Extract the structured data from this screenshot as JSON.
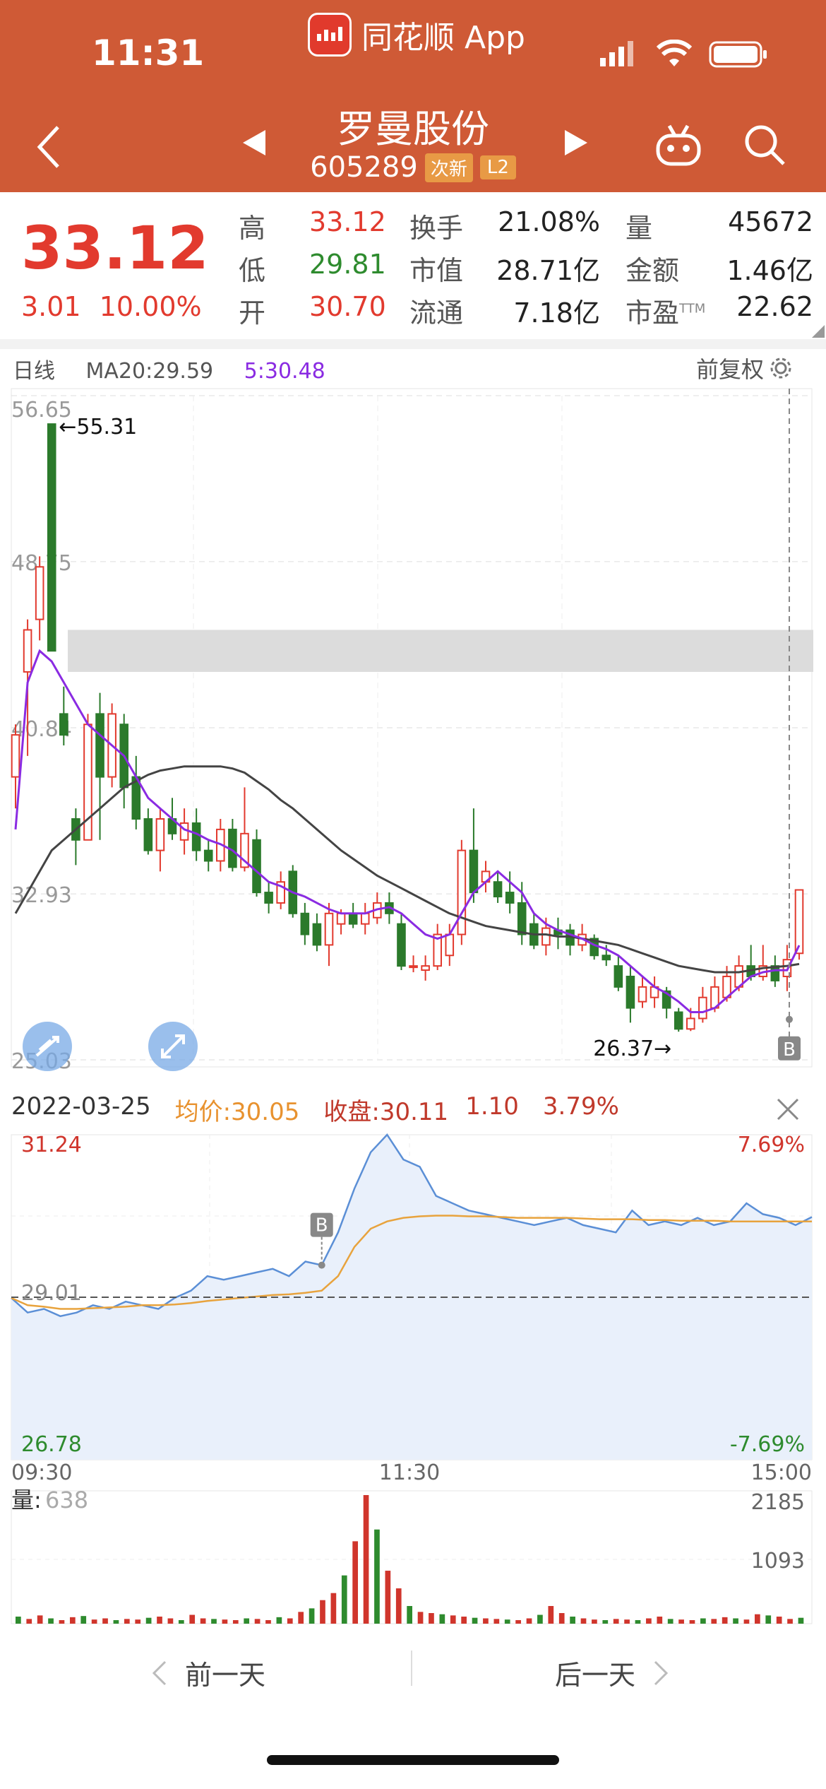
{
  "status": {
    "time": "11:31"
  },
  "header": {
    "app_name": "同花顺 App",
    "stock_name": "罗曼股份",
    "stock_code": "605289",
    "tag_new": "次新",
    "tag_level": "L2"
  },
  "quote": {
    "price": "33.12",
    "change": "3.01",
    "change_pct": "10.00%",
    "high_label": "高",
    "high": "33.12",
    "low_label": "低",
    "low": "29.81",
    "open_label": "开",
    "open": "30.70",
    "turnover_label": "换手",
    "turnover": "21.08%",
    "mktcap_label": "市值",
    "mktcap": "28.71亿",
    "float_label": "流通",
    "float": "7.18亿",
    "volume_label": "量",
    "volume": "45672",
    "amount_label": "金额",
    "amount": "1.46亿",
    "pe_label": "市盈",
    "pe_sup": "TTM",
    "pe": "22.62"
  },
  "kline": {
    "period": "日线",
    "ma20": "MA20:29.59",
    "ma5": "5:30.48",
    "adjust": "前复权",
    "y_ticks": [
      "56.65",
      "48.75",
      "40.84",
      "32.93",
      "25.03"
    ],
    "max_label": "←55.31",
    "min_label": "26.37→",
    "marker_b": "B",
    "colors": {
      "up": "#e23a2e",
      "down": "#2b7a2b",
      "ma5": "#8a2be2",
      "ma20": "#444444"
    }
  },
  "chart_data": [
    {
      "type": "candlestick",
      "title": "日线",
      "ylim": [
        25.03,
        56.65
      ],
      "candles": [
        {
          "o": 38.5,
          "c": 40.5,
          "h": 41,
          "l": 37
        },
        {
          "o": 43.5,
          "c": 45.5,
          "h": 46,
          "l": 39.5
        },
        {
          "o": 46,
          "c": 48.5,
          "h": 49,
          "l": 45
        },
        {
          "o": 55.3,
          "c": 44.5,
          "h": 55.31,
          "l": 44.5
        },
        {
          "o": 41.5,
          "c": 40.5,
          "h": 42.8,
          "l": 40
        },
        {
          "o": 36.5,
          "c": 35.5,
          "h": 37,
          "l": 34.3
        },
        {
          "o": 35.5,
          "c": 41,
          "h": 41.5,
          "l": 35.5
        },
        {
          "o": 41.5,
          "c": 38.5,
          "h": 42.5,
          "l": 35.5
        },
        {
          "o": 38.5,
          "c": 41.5,
          "h": 42,
          "l": 38
        },
        {
          "o": 41,
          "c": 38,
          "h": 41.5,
          "l": 37
        },
        {
          "o": 38.5,
          "c": 36.5,
          "h": 39.5,
          "l": 36
        },
        {
          "o": 36.5,
          "c": 35,
          "h": 37,
          "l": 34.8
        },
        {
          "o": 35,
          "c": 36.5,
          "h": 37,
          "l": 34
        },
        {
          "o": 36.5,
          "c": 35.8,
          "h": 37.5,
          "l": 35.5
        },
        {
          "o": 35.5,
          "c": 36.3,
          "h": 37,
          "l": 34.8
        },
        {
          "o": 36.3,
          "c": 35,
          "h": 37,
          "l": 34.5
        },
        {
          "o": 35,
          "c": 34.5,
          "h": 35.5,
          "l": 34
        },
        {
          "o": 34.5,
          "c": 36,
          "h": 36.5,
          "l": 34
        },
        {
          "o": 36,
          "c": 34.2,
          "h": 36.5,
          "l": 34
        },
        {
          "o": 34.2,
          "c": 35.8,
          "h": 38,
          "l": 34
        },
        {
          "o": 35.5,
          "c": 33,
          "h": 36,
          "l": 32.8
        },
        {
          "o": 33,
          "c": 32.5,
          "h": 33.5,
          "l": 32
        },
        {
          "o": 32.5,
          "c": 33.5,
          "h": 34,
          "l": 32.2
        },
        {
          "o": 34,
          "c": 32,
          "h": 34.3,
          "l": 31.8
        },
        {
          "o": 32,
          "c": 31,
          "h": 32.5,
          "l": 30.5
        },
        {
          "o": 31.5,
          "c": 30.5,
          "h": 32,
          "l": 30.2
        },
        {
          "o": 30.5,
          "c": 32,
          "h": 32.5,
          "l": 29.5
        },
        {
          "o": 31.5,
          "c": 32,
          "h": 32.2,
          "l": 31
        },
        {
          "o": 32,
          "c": 31.5,
          "h": 32.5,
          "l": 31.3
        },
        {
          "o": 31.5,
          "c": 32,
          "h": 32.5,
          "l": 31
        },
        {
          "o": 31.8,
          "c": 32.5,
          "h": 33,
          "l": 31.5
        },
        {
          "o": 32.5,
          "c": 32,
          "h": 33,
          "l": 31.5
        },
        {
          "o": 31.5,
          "c": 29.5,
          "h": 32,
          "l": 29.3
        },
        {
          "o": 29.5,
          "c": 29.5,
          "h": 30,
          "l": 29.2
        },
        {
          "o": 29.3,
          "c": 29.5,
          "h": 30,
          "l": 28.8
        },
        {
          "o": 29.5,
          "c": 31,
          "h": 31.5,
          "l": 29.3
        },
        {
          "o": 30,
          "c": 31,
          "h": 31.5,
          "l": 29.5
        },
        {
          "o": 31,
          "c": 35,
          "h": 35.5,
          "l": 30.5
        },
        {
          "o": 35,
          "c": 33,
          "h": 37,
          "l": 32.5
        },
        {
          "o": 33.5,
          "c": 34,
          "h": 34.5,
          "l": 33
        },
        {
          "o": 33.5,
          "c": 32.8,
          "h": 34,
          "l": 32.5
        },
        {
          "o": 33,
          "c": 32.5,
          "h": 34,
          "l": 32
        },
        {
          "o": 32.5,
          "c": 31,
          "h": 33.5,
          "l": 30.5
        },
        {
          "o": 31.5,
          "c": 30.5,
          "h": 32,
          "l": 30.3
        },
        {
          "o": 30.5,
          "c": 31.3,
          "h": 31.8,
          "l": 30
        },
        {
          "o": 31.2,
          "c": 31,
          "h": 31.8,
          "l": 30.3
        },
        {
          "o": 31.2,
          "c": 30.5,
          "h": 31.5,
          "l": 30
        },
        {
          "o": 30.5,
          "c": 31,
          "h": 31.5,
          "l": 30.2
        },
        {
          "o": 30.8,
          "c": 30,
          "h": 31,
          "l": 29.8
        },
        {
          "o": 30,
          "c": 29.8,
          "h": 30.5,
          "l": 29.5
        },
        {
          "o": 29.5,
          "c": 28.5,
          "h": 30,
          "l": 28.3
        },
        {
          "o": 29,
          "c": 27.5,
          "h": 29.5,
          "l": 26.8
        },
        {
          "o": 27.8,
          "c": 28.5,
          "h": 29,
          "l": 27.5
        },
        {
          "o": 28,
          "c": 28.5,
          "h": 29,
          "l": 27.5
        },
        {
          "o": 28.3,
          "c": 27.5,
          "h": 28.5,
          "l": 27
        },
        {
          "o": 27.3,
          "c": 26.5,
          "h": 27.5,
          "l": 26.37
        },
        {
          "o": 26.5,
          "c": 27,
          "h": 27.5,
          "l": 26.4
        },
        {
          "o": 27,
          "c": 28,
          "h": 28.5,
          "l": 26.8
        },
        {
          "o": 27.5,
          "c": 28.5,
          "h": 29,
          "l": 27.3
        },
        {
          "o": 28,
          "c": 29,
          "h": 29.5,
          "l": 27.8
        },
        {
          "o": 28.5,
          "c": 29.5,
          "h": 30,
          "l": 28.3
        },
        {
          "o": 29.5,
          "c": 29,
          "h": 30.5,
          "l": 28.8
        },
        {
          "o": 29,
          "c": 29.5,
          "h": 30.5,
          "l": 28.8
        },
        {
          "o": 29.5,
          "c": 28.8,
          "h": 30,
          "l": 28.5
        },
        {
          "o": 29,
          "c": 29.8,
          "h": 30.5,
          "l": 28.3
        },
        {
          "o": 30.1,
          "c": 33.12,
          "h": 33.12,
          "l": 29.8
        }
      ],
      "ma5": [
        36,
        43,
        44.5,
        44,
        43,
        42,
        41,
        40.5,
        40,
        39.5,
        38.5,
        37.5,
        37,
        36.5,
        36,
        35.8,
        35.5,
        35.3,
        35,
        34.5,
        34,
        33.5,
        33.3,
        33,
        32.8,
        32.5,
        32.2,
        32,
        32,
        32,
        32.2,
        32.3,
        32,
        31.5,
        31,
        30.8,
        31,
        32,
        33,
        33.5,
        34,
        33.5,
        33,
        32,
        31.5,
        31.2,
        31,
        30.8,
        30.5,
        30.3,
        30,
        29.5,
        29,
        28.5,
        28.2,
        27.8,
        27.3,
        27.3,
        27.5,
        28,
        28.5,
        29,
        29.2,
        29.3,
        29.3,
        30.48
      ],
      "ma20": [
        32,
        33,
        34,
        35,
        35.5,
        36,
        36.5,
        37,
        37.5,
        38,
        38.3,
        38.6,
        38.8,
        38.9,
        39,
        39,
        39,
        39,
        38.9,
        38.7,
        38.3,
        37.9,
        37.4,
        37,
        36.5,
        36,
        35.5,
        35,
        34.6,
        34.2,
        33.8,
        33.5,
        33.2,
        32.9,
        32.6,
        32.3,
        32,
        31.8,
        31.6,
        31.4,
        31.3,
        31.2,
        31.1,
        31,
        31,
        30.9,
        30.9,
        30.8,
        30.7,
        30.6,
        30.5,
        30.3,
        30.1,
        29.9,
        29.7,
        29.5,
        29.4,
        29.3,
        29.2,
        29.2,
        29.2,
        29.3,
        29.4,
        29.45,
        29.5,
        29.59
      ]
    },
    {
      "type": "line",
      "title": "2022-03-25",
      "x_labels": [
        "09:30",
        "11:30",
        "15:00"
      ],
      "ylim": [
        26.78,
        31.24
      ],
      "y_labels": [
        "31.24",
        "29.01",
        "26.78"
      ],
      "pct_labels": [
        "7.69%",
        "-7.69%"
      ],
      "series": [
        {
          "name": "收盘",
          "values": [
            29.0,
            28.8,
            28.85,
            28.75,
            28.8,
            28.9,
            28.85,
            28.95,
            28.9,
            28.85,
            29.0,
            29.1,
            29.3,
            29.25,
            29.3,
            29.35,
            29.4,
            29.3,
            29.5,
            29.45,
            29.9,
            30.5,
            31.0,
            31.24,
            30.9,
            30.8,
            30.4,
            30.3,
            30.2,
            30.15,
            30.1,
            30.05,
            30.0,
            30.05,
            30.1,
            30.0,
            29.95,
            29.9,
            30.2,
            30.0,
            30.05,
            30.0,
            30.1,
            30.0,
            30.05,
            30.3,
            30.15,
            30.1,
            30.0,
            30.11
          ]
        },
        {
          "name": "均价",
          "values": [
            29.0,
            28.9,
            28.88,
            28.85,
            28.85,
            28.86,
            28.87,
            28.88,
            28.9,
            28.9,
            28.91,
            28.93,
            28.96,
            28.98,
            29.0,
            29.02,
            29.04,
            29.05,
            29.07,
            29.1,
            29.3,
            29.7,
            29.95,
            30.05,
            30.1,
            30.12,
            30.13,
            30.13,
            30.12,
            30.12,
            30.11,
            30.1,
            30.1,
            30.1,
            30.1,
            30.09,
            30.08,
            30.08,
            30.08,
            30.07,
            30.07,
            30.06,
            30.06,
            30.06,
            30.05,
            30.05,
            30.05,
            30.05,
            30.05,
            30.05
          ]
        }
      ]
    },
    {
      "type": "bar",
      "title": "量",
      "y_labels": [
        "2185",
        "1093"
      ],
      "values": [
        120,
        80,
        140,
        90,
        60,
        110,
        130,
        70,
        90,
        60,
        80,
        70,
        100,
        120,
        90,
        60,
        150,
        90,
        80,
        70,
        60,
        90,
        80,
        60,
        110,
        90,
        200,
        260,
        400,
        520,
        820,
        1400,
        2185,
        1600,
        900,
        600,
        300,
        200,
        180,
        160,
        140,
        120,
        100,
        90,
        80,
        70,
        60,
        90,
        150,
        300,
        180,
        120,
        90,
        70,
        60,
        80,
        70,
        60,
        90,
        120,
        80,
        70,
        60,
        90,
        80,
        110,
        90,
        70,
        160,
        140,
        120,
        80,
        100
      ]
    }
  ],
  "day": {
    "date": "2022-03-25",
    "avg_price": "均价:30.05",
    "close": "收盘:30.11",
    "change": "1.10",
    "change_pct": "3.79%",
    "vol_label": "量:",
    "vol_value": "638"
  },
  "footer": {
    "prev_day": "前一天",
    "next_day": "后一天"
  }
}
